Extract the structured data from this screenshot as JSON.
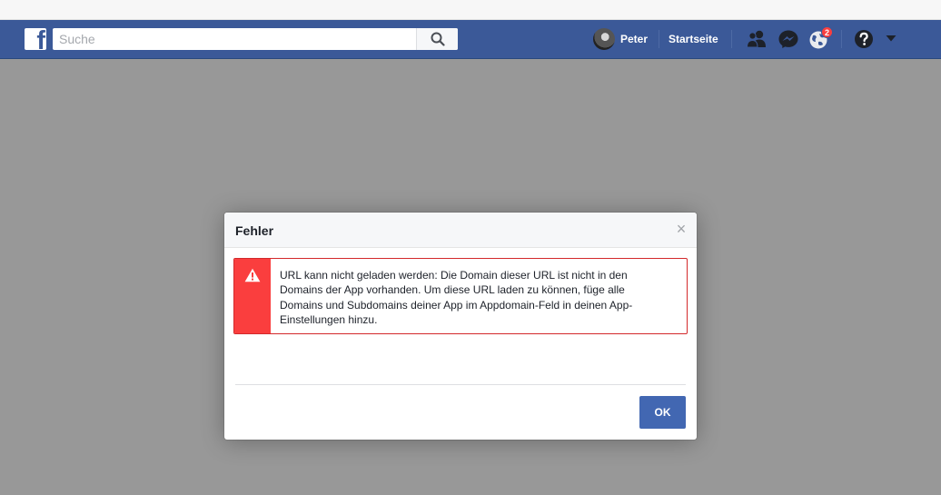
{
  "topbar": {
    "logo_letter": "f",
    "search_placeholder": "Suche",
    "user_name": "Peter",
    "home_label": "Startseite",
    "notifications_count": "2"
  },
  "dialog": {
    "title": "Fehler",
    "close_glyph": "×",
    "error_message": "URL kann nicht geladen werden: Die Domain dieser URL ist nicht in den Domains der App vorhanden. Um diese URL laden zu können, füge alle Domains und Subdomains deiner App im Appdomain-Feld in deinen App-Einstellungen hinzu.",
    "ok_label": "OK"
  },
  "colors": {
    "brand_blue": "#3b5998",
    "error_red": "#fa3e3e",
    "button_blue": "#4267b2",
    "overlay_gray": "#989898"
  },
  "icons": [
    "facebook-logo",
    "search-icon",
    "friend-requests-icon",
    "messenger-icon",
    "notifications-globe-icon",
    "help-icon",
    "chevron-down-icon",
    "warning-icon",
    "close-icon"
  ]
}
